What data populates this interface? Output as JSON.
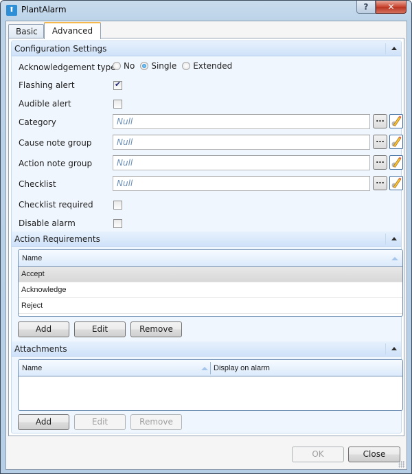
{
  "window": {
    "title": "PlantAlarm",
    "help_label": "?",
    "close_label": "✕",
    "app_icon": "plant-alarm-icon"
  },
  "tabs": [
    {
      "label": "Basic",
      "selected": false
    },
    {
      "label": "Advanced",
      "selected": true
    }
  ],
  "configuration": {
    "header": "Configuration Settings",
    "ack_type": {
      "label": "Acknowledgement type",
      "options": [
        "No",
        "Single",
        "Extended"
      ],
      "selected": "Single"
    },
    "flashing_alert": {
      "label": "Flashing alert",
      "checked": true
    },
    "audible_alert": {
      "label": "Audible alert",
      "checked": false
    },
    "lookups": [
      {
        "label": "Category",
        "value": "Null"
      },
      {
        "label": "Cause note group",
        "value": "Null"
      },
      {
        "label": "Action note group",
        "value": "Null"
      },
      {
        "label": "Checklist",
        "value": "Null"
      }
    ],
    "browse_label": "...",
    "checklist_required": {
      "label": "Checklist required",
      "checked": false
    },
    "disable_alarm": {
      "label": "Disable alarm",
      "checked": false
    }
  },
  "action_requirements": {
    "header": "Action Requirements",
    "columns": [
      "Name"
    ],
    "rows": [
      "Accept",
      "Acknowledge",
      "Reject"
    ],
    "selected_row": "Accept",
    "buttons": {
      "add": "Add",
      "edit": "Edit",
      "remove": "Remove"
    }
  },
  "attachments": {
    "header": "Attachments",
    "columns": [
      "Name",
      "Display on alarm"
    ],
    "rows": [],
    "buttons": {
      "add": "Add",
      "edit": "Edit",
      "remove": "Remove"
    },
    "edit_enabled": false,
    "remove_enabled": false
  },
  "footer": {
    "ok_label": "OK",
    "ok_enabled": false,
    "close_label": "Close"
  }
}
